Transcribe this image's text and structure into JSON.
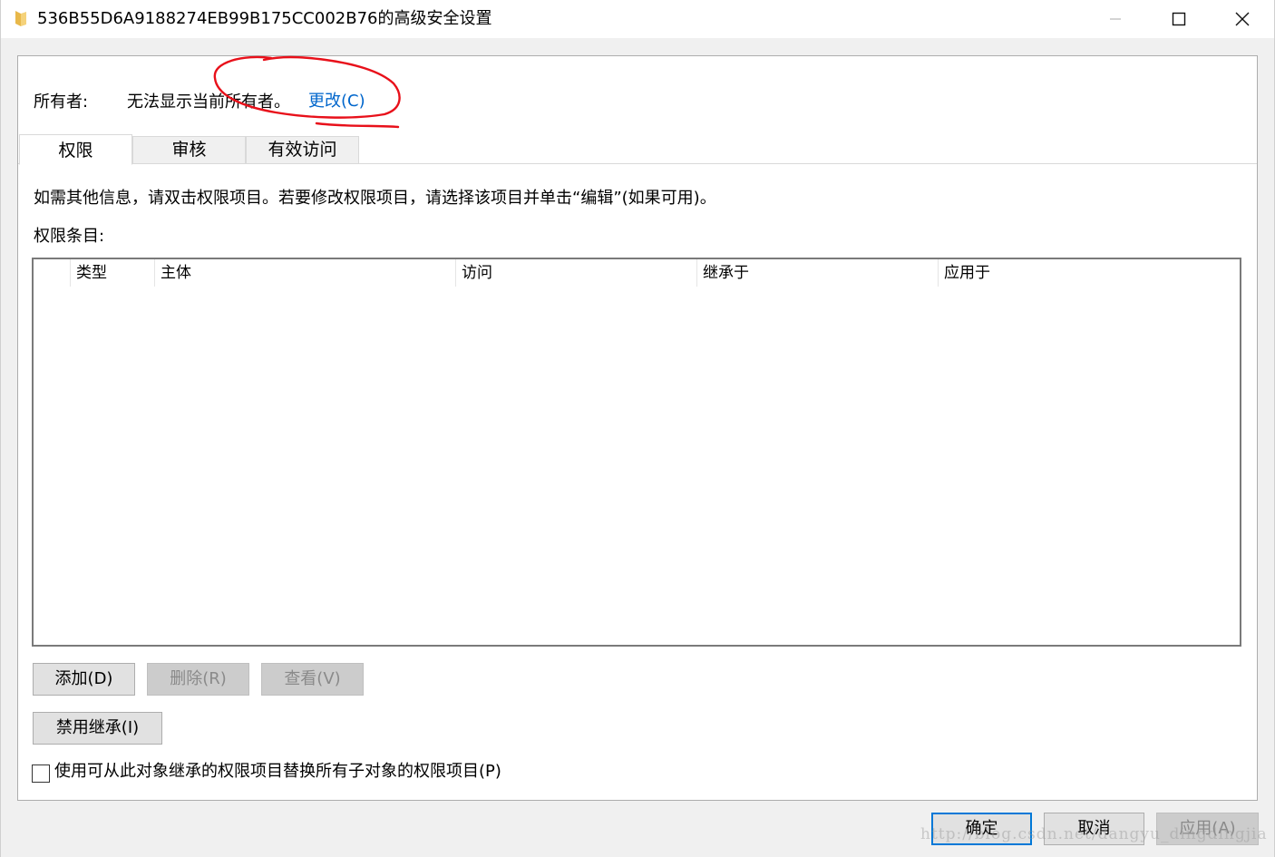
{
  "window": {
    "title": "536B55D6A9188274EB99B175CC002B76的高级安全设置"
  },
  "owner": {
    "label": "所有者:",
    "value": "无法显示当前所有者。",
    "change_link": "更改(C)"
  },
  "tabs": [
    {
      "label": "权限",
      "active": true
    },
    {
      "label": "审核",
      "active": false
    },
    {
      "label": "有效访问",
      "active": false
    }
  ],
  "info_text": "如需其他信息，请双击权限项目。若要修改权限项目，请选择该项目并单击“编辑”(如果可用)。",
  "entries_label": "权限条目:",
  "table": {
    "columns": [
      "类型",
      "主体",
      "访问",
      "继承于",
      "应用于"
    ],
    "rows": []
  },
  "buttons": {
    "add": "添加(D)",
    "remove": "删除(R)",
    "view": "查看(V)",
    "disable_inheritance": "禁用继承(I)",
    "ok": "确定",
    "cancel": "取消",
    "apply": "应用(A)"
  },
  "checkbox": {
    "label": "使用可从此对象继承的权限项目替换所有子对象的权限项目(P)",
    "checked": false
  },
  "watermark": "http://blog.csdn.net/dangyu_dingdingjia",
  "colors": {
    "link": "#0066cc",
    "annotation": "#e8101a",
    "default_button_border": "#0078d7"
  }
}
